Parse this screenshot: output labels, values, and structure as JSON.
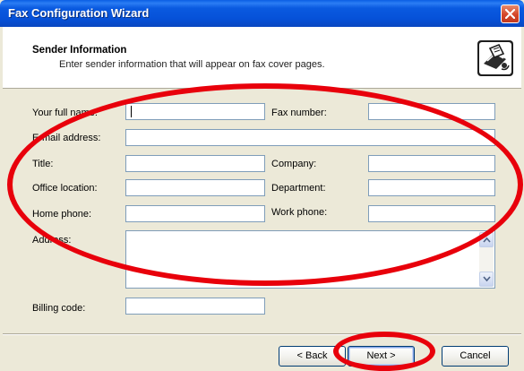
{
  "window": {
    "title": "Fax Configuration Wizard"
  },
  "header": {
    "title": "Sender Information",
    "subtitle": "Enter sender information that will appear on fax cover pages.",
    "icon": "fax-machine-icon"
  },
  "form": {
    "full_name": {
      "label": "Your full name:",
      "value": ""
    },
    "fax_number": {
      "label": "Fax number:",
      "value": ""
    },
    "email": {
      "label": "E-mail address:",
      "value": ""
    },
    "title": {
      "label": "Title:",
      "value": ""
    },
    "company": {
      "label": "Company:",
      "value": ""
    },
    "office_location": {
      "label": "Office location:",
      "value": ""
    },
    "department": {
      "label": "Department:",
      "value": ""
    },
    "home_phone": {
      "label": "Home phone:",
      "value": ""
    },
    "work_phone": {
      "label": "Work phone:",
      "value": ""
    },
    "address": {
      "label": "Address:",
      "value": ""
    },
    "billing_code": {
      "label": "Billing code:",
      "value": ""
    }
  },
  "buttons": {
    "back": "< Back",
    "next": "Next >",
    "cancel": "Cancel"
  },
  "colors": {
    "titlebar": "#0a5ae0",
    "annotation_oval": "#e8000b",
    "dialog_background": "#ece9d8"
  }
}
